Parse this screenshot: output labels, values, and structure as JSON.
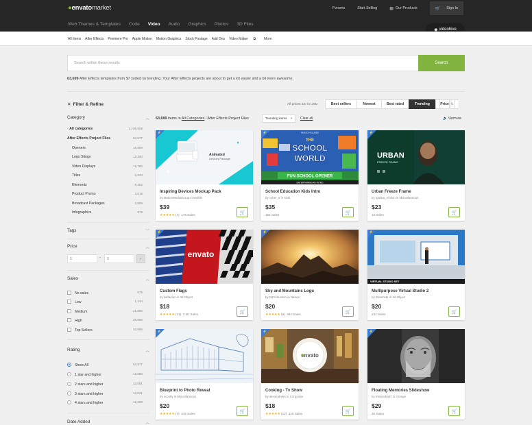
{
  "topbar": {
    "logo_brand": "envato",
    "logo_market": "market",
    "links": [
      "Forums",
      "Start Selling",
      "Our Products",
      "Sign In"
    ]
  },
  "nav": {
    "items": [
      "Web Themes & Templates",
      "Code",
      "Video",
      "Audio",
      "Graphics",
      "Photos",
      "3D Files"
    ],
    "active": "Video",
    "badge": "videohive"
  },
  "subnav": {
    "items": [
      "All Items",
      "After Effects",
      "Premiere Pro",
      "Apple Motion",
      "Motion Graphics",
      "Stock Footage",
      "Add Ons",
      "Video Maker",
      "More"
    ]
  },
  "search": {
    "placeholder": "Search within these results",
    "button": "Search"
  },
  "result_summary": {
    "count": "63,699",
    "text": " After Effects templates from $7 sorted by trending.  Your After Effects projects are about to get a lot easier and a bit more awesome."
  },
  "filter": {
    "title": "Filter & Refine",
    "category_label": "Category",
    "categories": [
      {
        "label": "All categories",
        "count": "1,108,929",
        "bold": true
      },
      {
        "label": "After Effects Project Files",
        "count": "63,677",
        "bold": true
      },
      {
        "label": "Openers",
        "count": "16,809"
      },
      {
        "label": "Logo Stings",
        "count": "13,280"
      },
      {
        "label": "Video Displays",
        "count": "12,780"
      },
      {
        "label": "Titles",
        "count": "6,243"
      },
      {
        "label": "Elements",
        "count": "5,262"
      },
      {
        "label": "Product Promo",
        "count": "3,615"
      },
      {
        "label": "Broadcast Packages",
        "count": "2,809"
      },
      {
        "label": "Infographics",
        "count": "978"
      }
    ],
    "tags_label": "Tags",
    "price_label": "Price",
    "price_currency": "$",
    "price_dash": "-",
    "price_go": "›",
    "sales_label": "Sales",
    "sales": [
      {
        "label": "No sales",
        "count": "975"
      },
      {
        "label": "Low",
        "count": "1,244"
      },
      {
        "label": "Medium",
        "count": "21,800"
      },
      {
        "label": "High",
        "count": "28,996"
      },
      {
        "label": "Top Sellers",
        "count": "10,665"
      }
    ],
    "rating_label": "Rating",
    "ratings": [
      {
        "label": "Show All",
        "count": "63,677",
        "selected": true
      },
      {
        "label": "1 star and higher",
        "count": "13,080"
      },
      {
        "label": "2 stars and higher",
        "count": "13,081"
      },
      {
        "label": "3 stars and higher",
        "count": "13,021"
      },
      {
        "label": "4 stars and higher",
        "count": "12,259"
      }
    ],
    "date_label": "Date Added"
  },
  "sort": {
    "price_note": "All prices are in USD",
    "options": [
      "Best sellers",
      "Newest",
      "Best rated",
      "Trending",
      "Price"
    ],
    "active": "Trending"
  },
  "crumb": {
    "count": "63,699",
    "in": " items in ",
    "link": "All Categories",
    "rest": " / After Effects Project Files",
    "tag": "Trending items",
    "tag_close": "×",
    "clear": "Clear all",
    "unmute": "Unmute"
  },
  "thumb_text": {
    "p1_line1": "Animated",
    "p1_line2": "Devices Package",
    "p2_top": "MUSIC INCLUDED",
    "p2_the": "THE",
    "p2_school": "SCHOOL",
    "p2_world": "WORLD",
    "p2_banner": "FUN SCHOOL OPENER",
    "p2_sub": "ENTERTAINING 4K INTRO",
    "p3_line1": "URBAN",
    "p3_line2": "FREEZE FRAME",
    "p4_logo": "envato",
    "p6_banner": "VIRTUAL STUDIO SET",
    "p8_logo": "envato"
  },
  "products": [
    {
      "title": "Inspiring Devices Mockup Pack",
      "author": "by MotionMediaGroup in Mobile",
      "price": "$39",
      "stars": "★★★★★",
      "reviews": "(4)",
      "sales": "179 Sales"
    },
    {
      "title": "School Education Kids Intro",
      "author": "by cyber_tr in Kids",
      "price": "$35",
      "stars": "",
      "reviews": "",
      "sales": "194 Sales"
    },
    {
      "title": "Urban Freeze Frame",
      "author": "by tgarika_motion in Miscellaneous",
      "price": "$23",
      "stars": "",
      "reviews": "",
      "sales": "18 Sales"
    },
    {
      "title": "Custom Flags",
      "author": "by karlaelon in 3d Object",
      "price": "$18",
      "stars": "★★★★★",
      "reviews": "(41)",
      "sales": "2.4K Sales"
    },
    {
      "title": "Sky and Mountains Logo",
      "author": "by DiProduction in Nature",
      "price": "$20",
      "stars": "★★★★★",
      "reviews": "(8)",
      "sales": "484 Sales"
    },
    {
      "title": "Multipurpose Virtual Studio 2",
      "author": "by Briannsbr in 3d Object",
      "price": "$20",
      "stars": "",
      "reviews": "",
      "sales": "234 Sales"
    },
    {
      "title": "Blueprint to Photo Reveal",
      "author": "by occolty in Miscellaneous",
      "price": "$20",
      "stars": "★★★★★",
      "reviews": "(4)",
      "sales": "445 Sales"
    },
    {
      "title": "Cooking - Tv Show",
      "author": "by alexandretts in Corporate",
      "price": "$18",
      "stars": "★★★★★",
      "reviews": "(12)",
      "sales": "318 Sales"
    },
    {
      "title": "Floating Memories Slideshow",
      "author": "by mismedia87 in Grunge",
      "price": "$29",
      "stars": "",
      "reviews": "",
      "sales": "30 Sales"
    }
  ]
}
